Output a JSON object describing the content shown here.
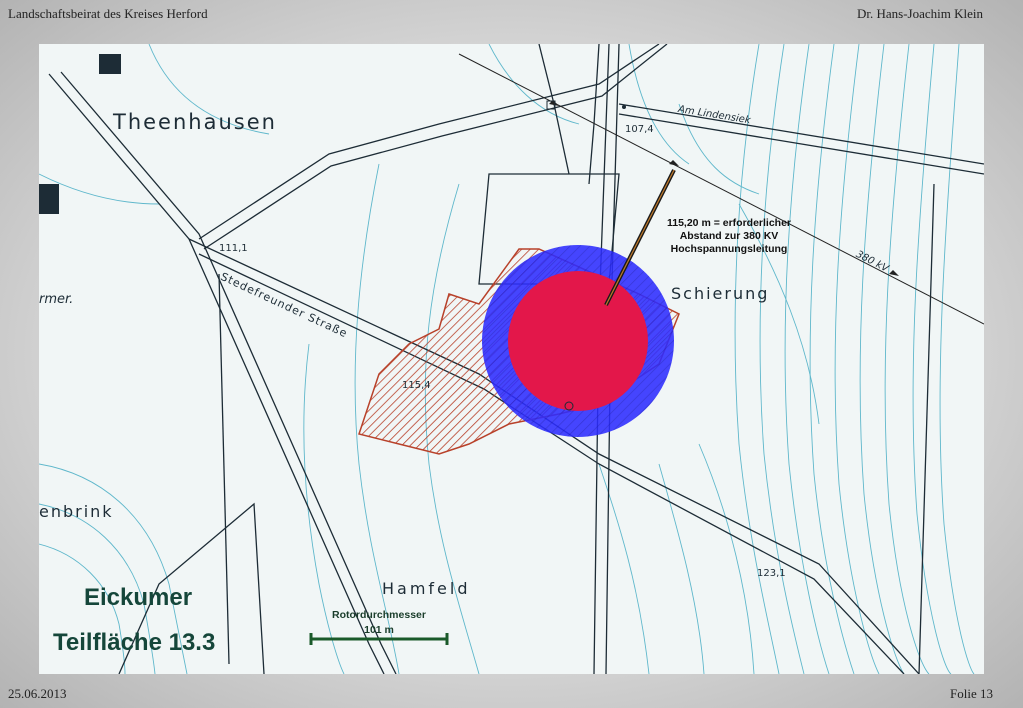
{
  "header": {
    "left": "Landschaftsbeirat des Kreises Herford",
    "right": "Dr. Hans-Joachim Klein"
  },
  "footer": {
    "date": "25.06.2013",
    "slide": "Folie 13"
  },
  "map": {
    "places": {
      "theenhausen": "Theenhausen",
      "schierung": "Schierung",
      "hamfeld": "Hamfeld",
      "enbrink": "enbrink",
      "rmer": "rmer."
    },
    "roads": {
      "lindensiek": "Am Lindensiek",
      "stedefreunder": "Stedefreunder Straße",
      "powerline": "380 kV"
    },
    "elevations": {
      "e1071": "107,4",
      "e1111": "111,1",
      "e1154": "115,4",
      "e1231": "123,1"
    },
    "annotation": {
      "line1": "115,20 m = erforderlicher",
      "line2": "Abstand zur 380 KV",
      "line3": "Hochspannungsleitung"
    },
    "title": {
      "line1": "Eickumer",
      "line2": "Teilfläche 13.3"
    },
    "scale": {
      "label": "Rotordurchmesser",
      "value": "101 m"
    },
    "colors": {
      "rotor": "#e3174a",
      "buffer": "#2c2cff",
      "area_hatch": "#b8412a",
      "contour": "#2fa3bd"
    }
  }
}
